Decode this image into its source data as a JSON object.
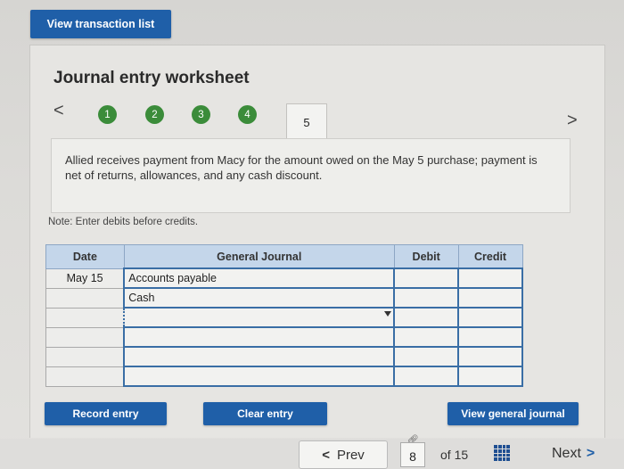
{
  "top": {
    "view_transactions_label": "View transaction list"
  },
  "worksheet": {
    "title": "Journal entry worksheet",
    "nav_prev": "<",
    "nav_next": ">",
    "steps": [
      "1",
      "2",
      "3",
      "4"
    ],
    "current_step": "5",
    "description": "Allied receives payment from Macy for the amount owed on the May 5 purchase; payment is net of returns, allowances, and any cash discount.",
    "note": "Note: Enter debits before credits."
  },
  "journal": {
    "headers": {
      "date": "Date",
      "account": "General Journal",
      "debit": "Debit",
      "credit": "Credit"
    },
    "rows": [
      {
        "date": "May 15",
        "account": "Accounts payable",
        "debit": "",
        "credit": ""
      },
      {
        "date": "",
        "account": "Cash",
        "debit": "",
        "credit": ""
      },
      {
        "date": "",
        "account": "",
        "debit": "",
        "credit": ""
      },
      {
        "date": "",
        "account": "",
        "debit": "",
        "credit": ""
      },
      {
        "date": "",
        "account": "",
        "debit": "",
        "credit": ""
      },
      {
        "date": "",
        "account": "",
        "debit": "",
        "credit": ""
      }
    ]
  },
  "buttons": {
    "record": "Record entry",
    "clear": "Clear entry",
    "view_general_journal": "View general journal"
  },
  "footer": {
    "prev_label": "Prev",
    "page": "8",
    "of_total": "of 15",
    "next_label": "Next",
    "prev_arrow": "<",
    "next_arrow": ">"
  },
  "colors": {
    "accent": "#1f5fa8",
    "step_complete": "#3b8c3a",
    "header_bg": "#c4d6ea"
  }
}
